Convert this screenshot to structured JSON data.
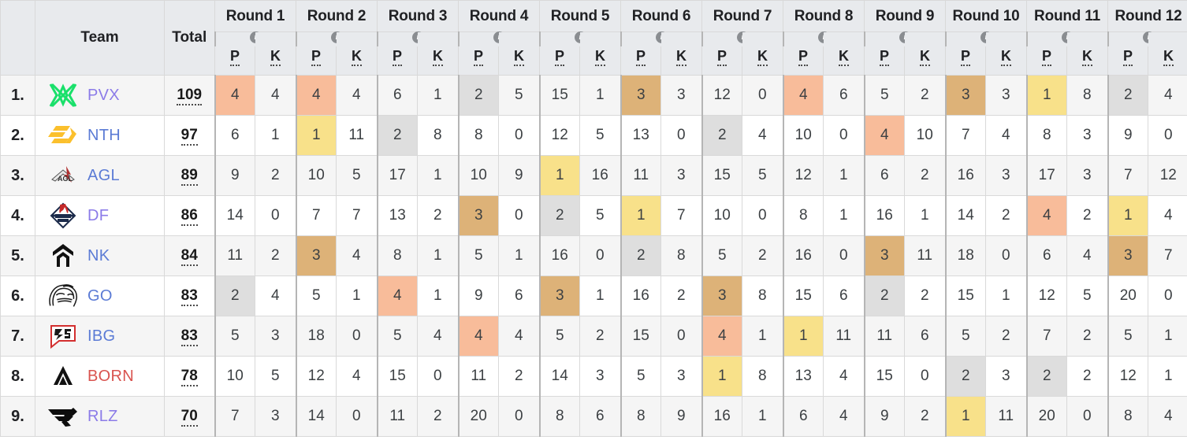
{
  "table": {
    "headers": {
      "rank": "",
      "team": "Team",
      "total": "Total",
      "p": "P",
      "k": "K",
      "info_icon": "info-icon"
    },
    "rounds": [
      "Round 1",
      "Round 2",
      "Round 3",
      "Round 4",
      "Round 5",
      "Round 6",
      "Round 7",
      "Round 8",
      "Round 9",
      "Round 10",
      "Round 11",
      "Round 12"
    ],
    "placement_colors": {
      "first": "#F8E18A",
      "second": "#DEDEDE",
      "third": "#DDB278",
      "fourth": "#F8BC9A",
      "none": ""
    },
    "rows": [
      {
        "rank": "1.",
        "team": "PVX",
        "team_color": "#8B7BE8",
        "logo": "pvx-logo",
        "total": "109",
        "stats": [
          {
            "p": "4",
            "k": "4",
            "hl": "fourth"
          },
          {
            "p": "4",
            "k": "4",
            "hl": "fourth"
          },
          {
            "p": "6",
            "k": "1",
            "hl": "none"
          },
          {
            "p": "2",
            "k": "5",
            "hl": "second"
          },
          {
            "p": "15",
            "k": "1",
            "hl": "none"
          },
          {
            "p": "3",
            "k": "3",
            "hl": "third"
          },
          {
            "p": "12",
            "k": "0",
            "hl": "none"
          },
          {
            "p": "4",
            "k": "6",
            "hl": "fourth"
          },
          {
            "p": "5",
            "k": "2",
            "hl": "none"
          },
          {
            "p": "3",
            "k": "3",
            "hl": "third"
          },
          {
            "p": "1",
            "k": "8",
            "hl": "first"
          },
          {
            "p": "2",
            "k": "4",
            "hl": "second"
          }
        ]
      },
      {
        "rank": "2.",
        "team": "NTH",
        "team_color": "#5B7BD5",
        "logo": "nth-logo",
        "total": "97",
        "stats": [
          {
            "p": "6",
            "k": "1",
            "hl": "none"
          },
          {
            "p": "1",
            "k": "11",
            "hl": "first"
          },
          {
            "p": "2",
            "k": "8",
            "hl": "second"
          },
          {
            "p": "8",
            "k": "0",
            "hl": "none"
          },
          {
            "p": "12",
            "k": "5",
            "hl": "none"
          },
          {
            "p": "13",
            "k": "0",
            "hl": "none"
          },
          {
            "p": "2",
            "k": "4",
            "hl": "second"
          },
          {
            "p": "10",
            "k": "0",
            "hl": "none"
          },
          {
            "p": "4",
            "k": "10",
            "hl": "fourth"
          },
          {
            "p": "7",
            "k": "4",
            "hl": "none"
          },
          {
            "p": "8",
            "k": "3",
            "hl": "none"
          },
          {
            "p": "9",
            "k": "0",
            "hl": "none"
          }
        ]
      },
      {
        "rank": "3.",
        "team": "AGL",
        "team_color": "#5B7BD5",
        "logo": "agl-logo",
        "total": "89",
        "stats": [
          {
            "p": "9",
            "k": "2",
            "hl": "none"
          },
          {
            "p": "10",
            "k": "5",
            "hl": "none"
          },
          {
            "p": "17",
            "k": "1",
            "hl": "none"
          },
          {
            "p": "10",
            "k": "9",
            "hl": "none"
          },
          {
            "p": "1",
            "k": "16",
            "hl": "first"
          },
          {
            "p": "11",
            "k": "3",
            "hl": "none"
          },
          {
            "p": "15",
            "k": "5",
            "hl": "none"
          },
          {
            "p": "12",
            "k": "1",
            "hl": "none"
          },
          {
            "p": "6",
            "k": "2",
            "hl": "none"
          },
          {
            "p": "16",
            "k": "3",
            "hl": "none"
          },
          {
            "p": "17",
            "k": "3",
            "hl": "none"
          },
          {
            "p": "7",
            "k": "12",
            "hl": "none"
          }
        ]
      },
      {
        "rank": "4.",
        "team": "DF",
        "team_color": "#8B7BE8",
        "logo": "df-logo",
        "total": "86",
        "stats": [
          {
            "p": "14",
            "k": "0",
            "hl": "none"
          },
          {
            "p": "7",
            "k": "7",
            "hl": "none"
          },
          {
            "p": "13",
            "k": "2",
            "hl": "none"
          },
          {
            "p": "3",
            "k": "0",
            "hl": "third"
          },
          {
            "p": "2",
            "k": "5",
            "hl": "second"
          },
          {
            "p": "1",
            "k": "7",
            "hl": "first"
          },
          {
            "p": "10",
            "k": "0",
            "hl": "none"
          },
          {
            "p": "8",
            "k": "1",
            "hl": "none"
          },
          {
            "p": "16",
            "k": "1",
            "hl": "none"
          },
          {
            "p": "14",
            "k": "2",
            "hl": "none"
          },
          {
            "p": "4",
            "k": "2",
            "hl": "fourth"
          },
          {
            "p": "1",
            "k": "4",
            "hl": "first"
          }
        ]
      },
      {
        "rank": "5.",
        "team": "NK",
        "team_color": "#5B7BD5",
        "logo": "nk-logo",
        "total": "84",
        "stats": [
          {
            "p": "11",
            "k": "2",
            "hl": "none"
          },
          {
            "p": "3",
            "k": "4",
            "hl": "third"
          },
          {
            "p": "8",
            "k": "1",
            "hl": "none"
          },
          {
            "p": "5",
            "k": "1",
            "hl": "none"
          },
          {
            "p": "16",
            "k": "0",
            "hl": "none"
          },
          {
            "p": "2",
            "k": "8",
            "hl": "second"
          },
          {
            "p": "5",
            "k": "2",
            "hl": "none"
          },
          {
            "p": "16",
            "k": "0",
            "hl": "none"
          },
          {
            "p": "3",
            "k": "11",
            "hl": "third"
          },
          {
            "p": "18",
            "k": "0",
            "hl": "none"
          },
          {
            "p": "6",
            "k": "4",
            "hl": "none"
          },
          {
            "p": "3",
            "k": "7",
            "hl": "third"
          }
        ]
      },
      {
        "rank": "6.",
        "team": "GO",
        "team_color": "#5B7BD5",
        "logo": "go-logo",
        "total": "83",
        "stats": [
          {
            "p": "2",
            "k": "4",
            "hl": "second"
          },
          {
            "p": "5",
            "k": "1",
            "hl": "none"
          },
          {
            "p": "4",
            "k": "1",
            "hl": "fourth"
          },
          {
            "p": "9",
            "k": "6",
            "hl": "none"
          },
          {
            "p": "3",
            "k": "1",
            "hl": "third"
          },
          {
            "p": "16",
            "k": "2",
            "hl": "none"
          },
          {
            "p": "3",
            "k": "8",
            "hl": "third"
          },
          {
            "p": "15",
            "k": "6",
            "hl": "none"
          },
          {
            "p": "2",
            "k": "2",
            "hl": "second"
          },
          {
            "p": "15",
            "k": "1",
            "hl": "none"
          },
          {
            "p": "12",
            "k": "5",
            "hl": "none"
          },
          {
            "p": "20",
            "k": "0",
            "hl": "none"
          }
        ]
      },
      {
        "rank": "7.",
        "team": "IBG",
        "team_color": "#5B7BD5",
        "logo": "ibg-logo",
        "total": "83",
        "stats": [
          {
            "p": "5",
            "k": "3",
            "hl": "none"
          },
          {
            "p": "18",
            "k": "0",
            "hl": "none"
          },
          {
            "p": "5",
            "k": "4",
            "hl": "none"
          },
          {
            "p": "4",
            "k": "4",
            "hl": "fourth"
          },
          {
            "p": "5",
            "k": "2",
            "hl": "none"
          },
          {
            "p": "15",
            "k": "0",
            "hl": "none"
          },
          {
            "p": "4",
            "k": "1",
            "hl": "fourth"
          },
          {
            "p": "1",
            "k": "11",
            "hl": "first"
          },
          {
            "p": "11",
            "k": "6",
            "hl": "none"
          },
          {
            "p": "5",
            "k": "2",
            "hl": "none"
          },
          {
            "p": "7",
            "k": "2",
            "hl": "none"
          },
          {
            "p": "5",
            "k": "1",
            "hl": "none"
          }
        ]
      },
      {
        "rank": "8.",
        "team": "BORN",
        "team_color": "#D9534F",
        "logo": "born-logo",
        "total": "78",
        "stats": [
          {
            "p": "10",
            "k": "5",
            "hl": "none"
          },
          {
            "p": "12",
            "k": "4",
            "hl": "none"
          },
          {
            "p": "15",
            "k": "0",
            "hl": "none"
          },
          {
            "p": "11",
            "k": "2",
            "hl": "none"
          },
          {
            "p": "14",
            "k": "3",
            "hl": "none"
          },
          {
            "p": "5",
            "k": "3",
            "hl": "none"
          },
          {
            "p": "1",
            "k": "8",
            "hl": "first"
          },
          {
            "p": "13",
            "k": "4",
            "hl": "none"
          },
          {
            "p": "15",
            "k": "0",
            "hl": "none"
          },
          {
            "p": "2",
            "k": "3",
            "hl": "second"
          },
          {
            "p": "2",
            "k": "2",
            "hl": "second"
          },
          {
            "p": "12",
            "k": "1",
            "hl": "none"
          }
        ]
      },
      {
        "rank": "9.",
        "team": "RLZ",
        "team_color": "#8B7BE8",
        "logo": "rlz-logo",
        "total": "70",
        "stats": [
          {
            "p": "7",
            "k": "3",
            "hl": "none"
          },
          {
            "p": "14",
            "k": "0",
            "hl": "none"
          },
          {
            "p": "11",
            "k": "2",
            "hl": "none"
          },
          {
            "p": "20",
            "k": "0",
            "hl": "none"
          },
          {
            "p": "8",
            "k": "6",
            "hl": "none"
          },
          {
            "p": "8",
            "k": "9",
            "hl": "none"
          },
          {
            "p": "16",
            "k": "1",
            "hl": "none"
          },
          {
            "p": "6",
            "k": "4",
            "hl": "none"
          },
          {
            "p": "9",
            "k": "2",
            "hl": "none"
          },
          {
            "p": "1",
            "k": "11",
            "hl": "first"
          },
          {
            "p": "20",
            "k": "0",
            "hl": "none"
          },
          {
            "p": "8",
            "k": "4",
            "hl": "none"
          }
        ]
      }
    ]
  }
}
